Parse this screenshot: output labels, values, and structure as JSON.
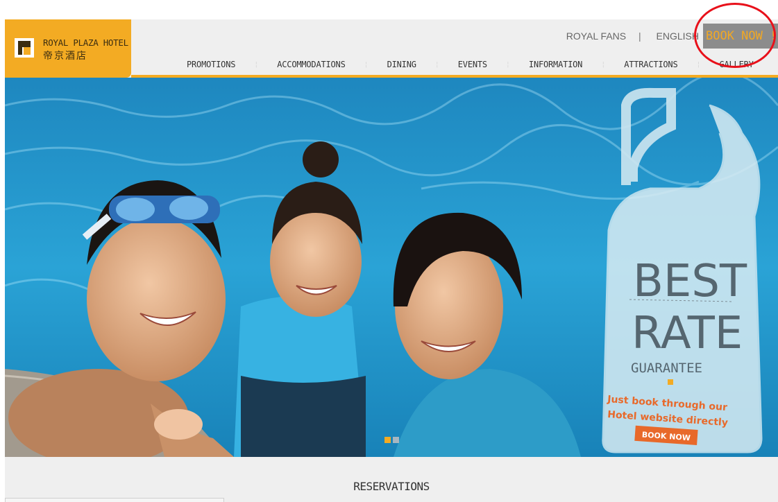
{
  "header": {
    "logo": {
      "name_en": "ROYAL PLAZA HOTEL",
      "name_zh": "帝京酒店",
      "mark_icon": "logo-r-icon"
    },
    "top_links": {
      "royal_fans": "ROYAL FANS",
      "separator": "|",
      "language": "ENGLISH"
    },
    "book_now": "BOOK NOW !",
    "nav": [
      {
        "label": "PROMOTIONS"
      },
      {
        "label": "ACCOMMODATIONS"
      },
      {
        "label": "DINING"
      },
      {
        "label": "EVENTS"
      },
      {
        "label": "INFORMATION"
      },
      {
        "label": "ATTRACTIONS"
      },
      {
        "label": "GALLERY"
      }
    ]
  },
  "hero": {
    "promo": {
      "line1": "BEST",
      "line2": "RATE",
      "line3": "GUARANTEE",
      "sub1": "Just book through our",
      "sub2": "Hotel website directly",
      "button": "BOOK NOW"
    },
    "carousel_active": 1,
    "carousel_count": 2
  },
  "section": {
    "reservations": "RESERVATIONS"
  },
  "colors": {
    "brand_gold": "#f3ab23",
    "book_button_bg": "#8c8c8c",
    "page_bg": "#efefef",
    "annotation_circle": "#e8101a",
    "promo_button": "#e8692a"
  }
}
